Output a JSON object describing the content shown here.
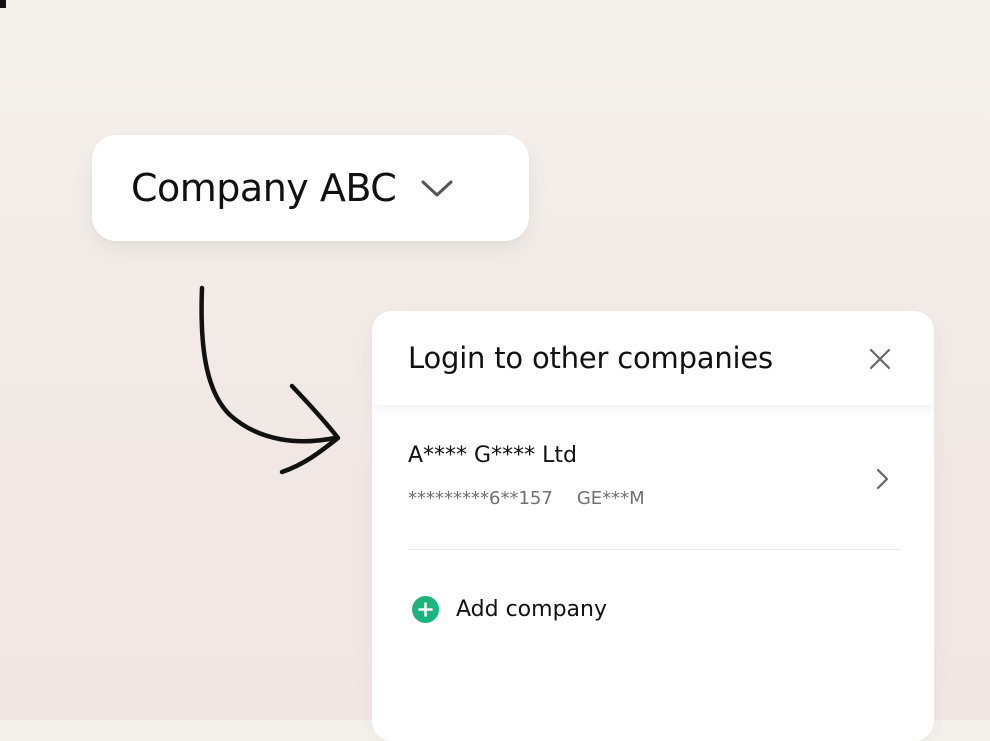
{
  "company_selector": {
    "name": "Company ABC",
    "icon": "chevron-down-icon"
  },
  "decoration": {
    "arrow_icon": "curved-arrow-icon",
    "ink_color": "#111111"
  },
  "login_panel": {
    "title": "Login to other companies",
    "close_icon": "close-icon",
    "companies": [
      {
        "name": "A**** G**** Ltd",
        "id_number": "*********6**157",
        "code": "GE***M",
        "icon": "chevron-right-icon"
      }
    ],
    "add_company": {
      "label": "Add company",
      "icon": "plus-circle-icon",
      "accent_color": "#1ab47c"
    }
  }
}
